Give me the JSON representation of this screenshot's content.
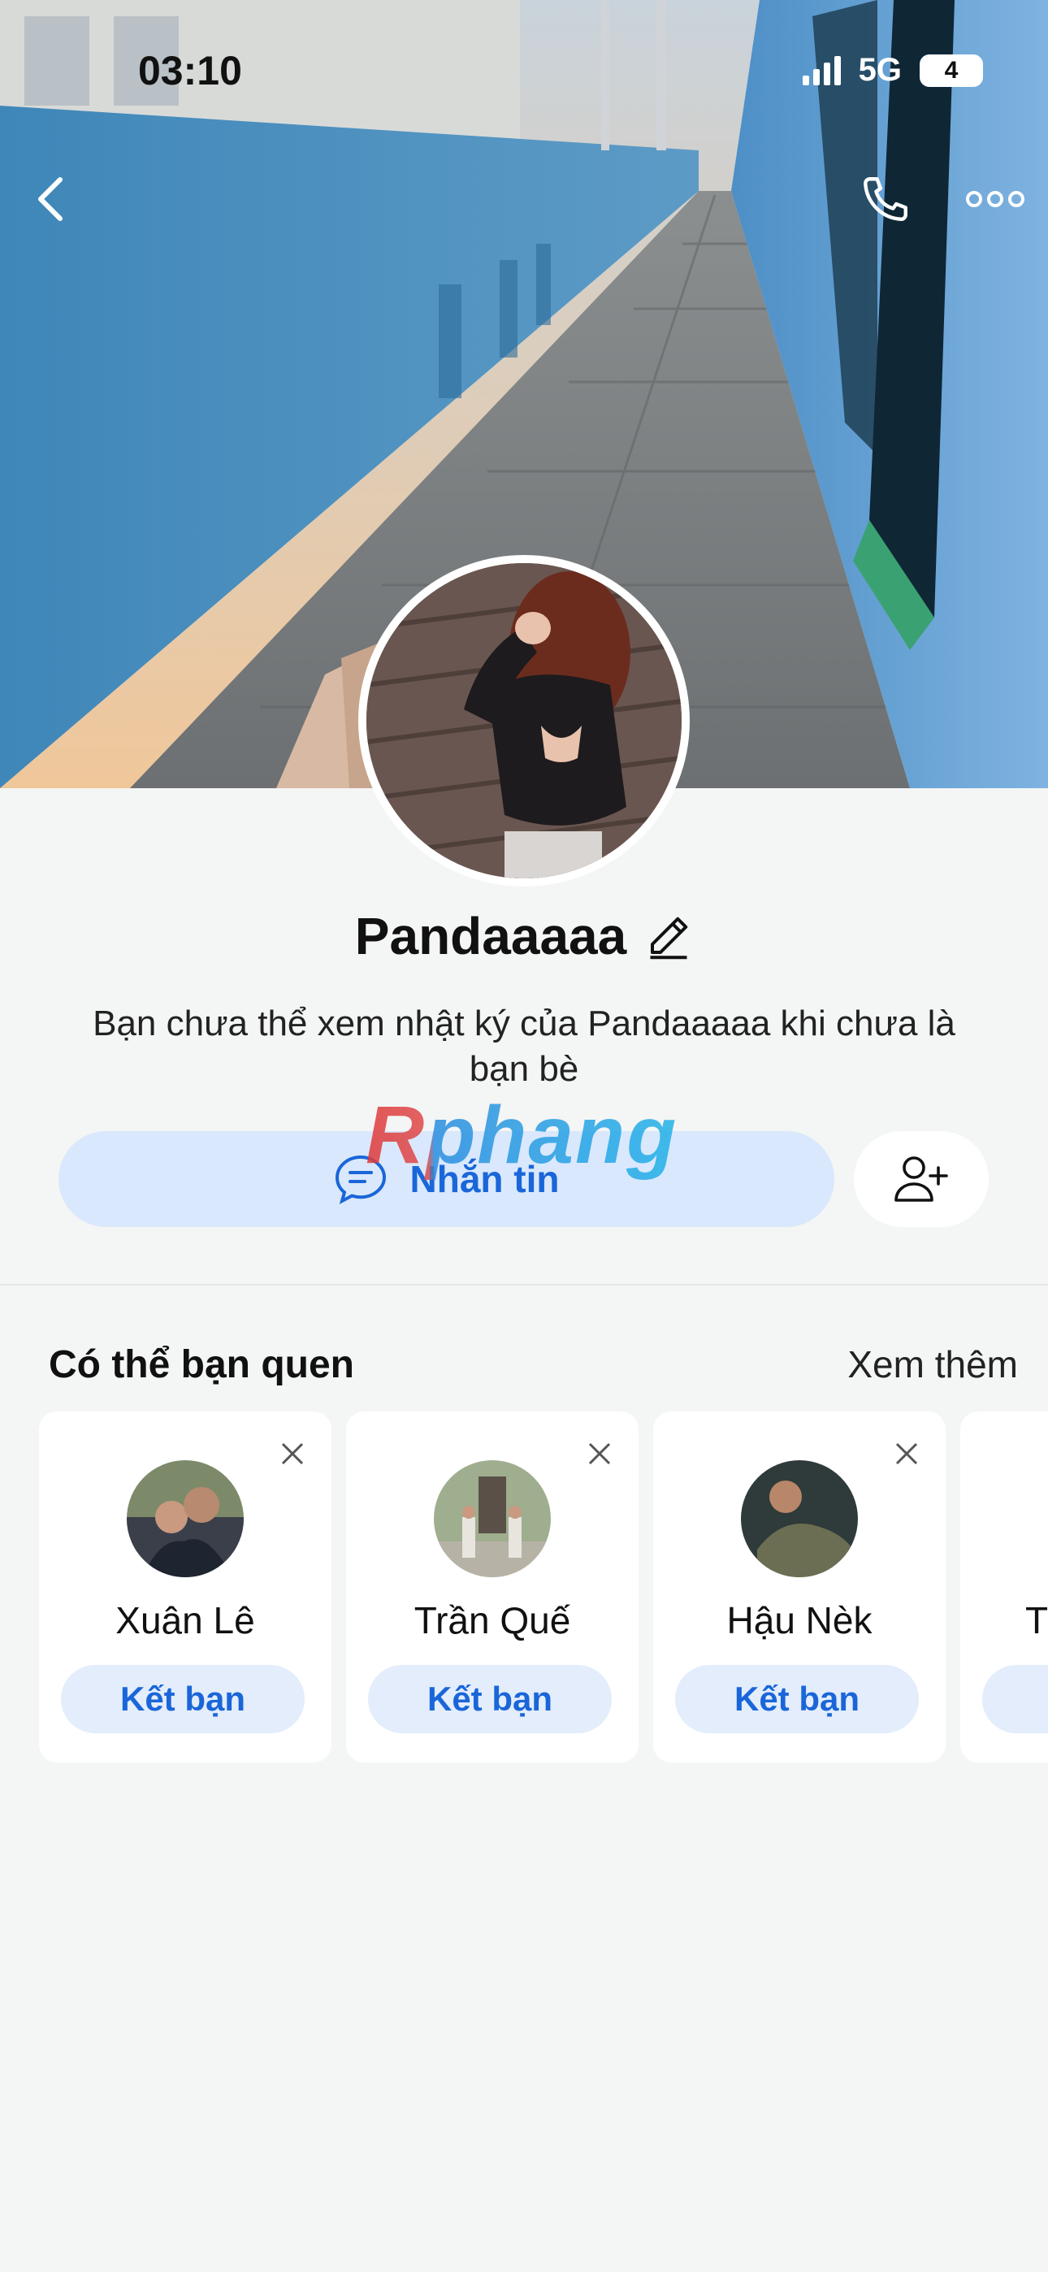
{
  "status_bar": {
    "time": "03:10",
    "network": "5G",
    "battery": "4"
  },
  "nav": {
    "back_icon": "chevron-left-icon",
    "call_icon": "phone-icon",
    "more_icon": "more-horizontal-icon"
  },
  "profile": {
    "name": "Pandaaaaa",
    "diary_note": "Bạn chưa thể xem nhật ký của Pandaaaaa khi chưa là bạn bè"
  },
  "actions": {
    "message_label": "Nhắn tin",
    "message_icon": "chat-bubble-icon",
    "add_friend_icon": "add-user-icon"
  },
  "watermark": "Rphang",
  "suggestions": {
    "title": "Có thể bạn quen",
    "see_more": "Xem thêm",
    "cards": [
      {
        "name": "Xuân Lê",
        "button": "Kết bạn"
      },
      {
        "name": "Trần Quế",
        "button": "Kết bạn"
      },
      {
        "name": "Hậu Nèk",
        "button": "Kết bạn"
      },
      {
        "name": "T",
        "button": ""
      }
    ]
  },
  "colors": {
    "accent": "#1a66d9",
    "message_button_bg": "#d9e8fc",
    "card_button_bg": "#e3edfb",
    "page_bg": "#f4f5f5"
  }
}
